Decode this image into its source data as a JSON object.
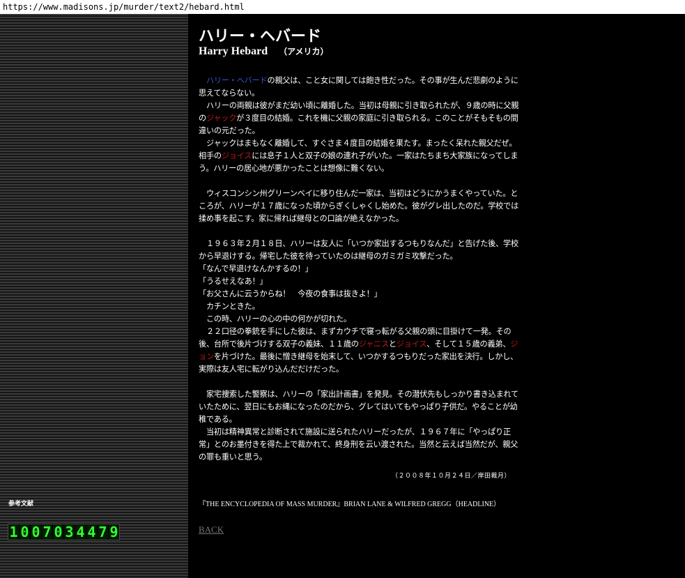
{
  "url": "https://www.madisons.jp/murder/text2/hebard.html",
  "title_jp": "ハリー・ヘバード",
  "title_en": "Harry Hebard",
  "country": "（アメリカ）",
  "article": [
    {
      "segments": [
        {
          "t": "　"
        },
        {
          "t": "ハリー・ヘバード",
          "c": "blue"
        },
        {
          "t": "の親父は、こと女に関しては飽き性だった。その事が生んだ悲劇のように思えてならない。"
        }
      ]
    },
    {
      "segments": [
        {
          "t": "　ハリーの両親は彼がまだ幼い頃に離婚した。当初は母親に引き取られたが、９歳の時に父親の"
        },
        {
          "t": "ジャック",
          "c": "red"
        },
        {
          "t": "が３度目の結婚。これを機に父親の家庭に引き取られる。このことがそもそもの間違いの元だった。"
        }
      ]
    },
    {
      "segments": [
        {
          "t": "　ジャックはまもなく離婚して、すぐさま４度目の結婚を果たす。まったく呆れた親父だぜ。相手の"
        },
        {
          "t": "ジョイス",
          "c": "red"
        },
        {
          "t": "には息子１人と双子の娘の連れ子がいた。一家はたちまち大家族になってしまう。ハリーの居心地が悪かったことは想像に難くない。"
        }
      ]
    },
    {
      "blank": true
    },
    {
      "segments": [
        {
          "t": "　ウィスコンシン州グリーンベイに移り住んだ一家は、当初はどうにかうまくやっていた。ところが、ハリーが１７歳になった頃からぎくしゃくし始めた。彼がグレ出したのだ。学校では揉め事を起こす。家に帰れば継母との口論が絶えなかった。"
        }
      ]
    },
    {
      "blank": true
    },
    {
      "segments": [
        {
          "t": "　１９６３年２月１８日、ハリーは友人に「いつか家出するつもりなんだ」と告げた後、学校から早退けする。帰宅した彼を待っていたのは継母のガミガミ攻撃だった。"
        }
      ]
    },
    {
      "segments": [
        {
          "t": "「なんで早退けなんかするの！」"
        }
      ]
    },
    {
      "segments": [
        {
          "t": "「うるせえなあ！」"
        }
      ]
    },
    {
      "segments": [
        {
          "t": "「お父さんに云うからね！　今夜の食事は抜きよ！」"
        }
      ]
    },
    {
      "segments": [
        {
          "t": "　カチンときた。"
        }
      ]
    },
    {
      "segments": [
        {
          "t": "　この時、ハリーの心の中の何かが切れた。"
        }
      ]
    },
    {
      "segments": [
        {
          "t": "　２２口径の拳銃を手にした彼は、まずカウチで寝っ転がる父親の頭に目掛けて一発。その後、台所で後片づけする双子の義妹、１１歳の"
        },
        {
          "t": "ジャニス",
          "c": "red"
        },
        {
          "t": "と"
        },
        {
          "t": "ジョイス",
          "c": "red"
        },
        {
          "t": "、そして１５歳の義弟、"
        },
        {
          "t": "ジョン",
          "c": "red"
        },
        {
          "t": "を片づけた。最後に憎き継母を始末して、いつかするつもりだった家出を決行。しかし、実際は友人宅に転がり込んだだけだった。"
        }
      ]
    },
    {
      "blank": true
    },
    {
      "segments": [
        {
          "t": "　家宅捜索した警察は、ハリーの「家出計画書」を発見。その潜伏先もしっかり書き込まれていたために、翌日にもお縄になったのだから、グレてはいてもやっぱり子供だ。やることが幼稚である。"
        }
      ]
    },
    {
      "segments": [
        {
          "t": "　当初は精神異常と診断されて施設に送られたハリーだったが、１９６７年に「やっぱり正常」とのお墨付きを得た上で裁かれて、終身刑を云い渡された。当然と云えば当然だが、親父の罪も重いと思う。"
        }
      ]
    }
  ],
  "date_line": "（２００８年１０月２４日／岸田裁月）",
  "bibliography": "『THE ENCYCLOPEDIA OF MASS MURDER』BRIAN LANE & WILFRED GREGG（HEADLINE）",
  "back_label": "BACK",
  "sidebar": {
    "reference_label": "参考文献",
    "counter_digits": "1007034479"
  },
  "colors": {
    "background": "#000000",
    "text": "#ffffff",
    "name_blue": "#3b54d6",
    "name_red": "#c01818",
    "counter_green": "#31ff31",
    "back_link": "#777777"
  }
}
